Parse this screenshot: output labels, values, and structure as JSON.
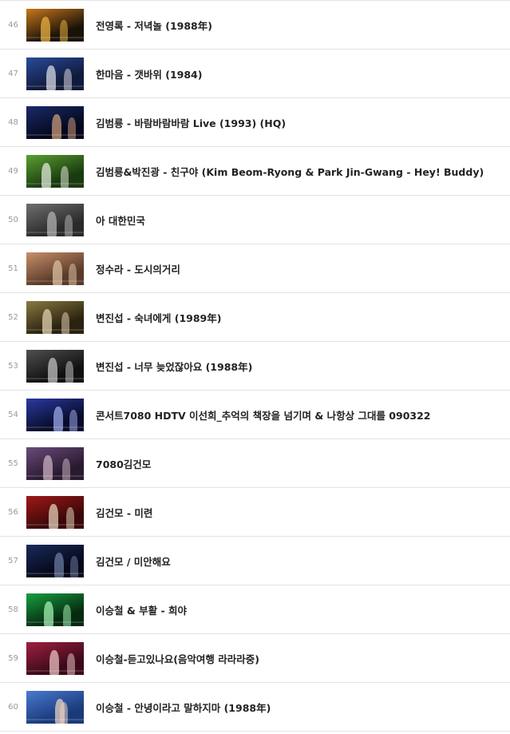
{
  "videos": [
    {
      "index": "46",
      "title": "전영록 - 저녁놀 (1988年)",
      "thumb": "sunset-silhouette-thumbnail",
      "colors": [
        "#1a1208",
        "#c8781c",
        "#e8b040"
      ]
    },
    {
      "index": "47",
      "title": "한마음 - 갯바위 (1984)",
      "thumb": "duet-singers-thumbnail",
      "colors": [
        "#101a3a",
        "#2a4a9a",
        "#d8d8e0"
      ]
    },
    {
      "index": "48",
      "title": "김범룡 - 바람바람바람 Live (1993) (HQ)",
      "thumb": "singer-closeup-thumbnail",
      "colors": [
        "#05081c",
        "#1a2a6a",
        "#c89a7a"
      ]
    },
    {
      "index": "49",
      "title": "김범룡&박진광 - 친구야 (Kim Beom-Ryong & Park Jin-Gwang - Hey! Buddy)",
      "thumb": "green-stage-duo-thumbnail",
      "colors": [
        "#1a3a10",
        "#5aa030",
        "#e0e8d8"
      ]
    },
    {
      "index": "50",
      "title": "아 대한민국",
      "thumb": "city-skyline-thumbnail",
      "colors": [
        "#2a2a2a",
        "#707070",
        "#b0b0b0"
      ]
    },
    {
      "index": "51",
      "title": "정수라 - 도시의거리",
      "thumb": "dancers-stage-thumbnail",
      "colors": [
        "#5a3a2a",
        "#c8906a",
        "#d8c0a0"
      ]
    },
    {
      "index": "52",
      "title": "변진섭 - 숙녀에게 (1989年)",
      "thumb": "woman-portrait-thumbnail",
      "colors": [
        "#2a2210",
        "#8a7a40",
        "#e0d0b0"
      ]
    },
    {
      "index": "53",
      "title": "변진섭 - 너무 늦었잖아요 (1988年)",
      "thumb": "black-white-scene-thumbnail",
      "colors": [
        "#101010",
        "#505050",
        "#c0c0c0"
      ]
    },
    {
      "index": "54",
      "title": "콘서트7080 HDTV 이선희_추억의 책장을 넘기며 & 나항상 그대를 090322",
      "thumb": "concert-stage-blue-thumbnail",
      "colors": [
        "#080c2a",
        "#2a3aa0",
        "#9aa8e8"
      ]
    },
    {
      "index": "55",
      "title": "7080김건모",
      "thumb": "purple-studio-thumbnail",
      "colors": [
        "#2a1a30",
        "#6a4a7a",
        "#c8b0c0"
      ]
    },
    {
      "index": "56",
      "title": "김건모 - 미련",
      "thumb": "singer-red-background-thumbnail",
      "colors": [
        "#3a0808",
        "#a01818",
        "#e0d0b8"
      ]
    },
    {
      "index": "57",
      "title": "김건모 / 미안해요",
      "thumb": "dark-piano-stage-thumbnail",
      "colors": [
        "#050818",
        "#1a2a5a",
        "#6a7aa0"
      ]
    },
    {
      "index": "58",
      "title": "이승철 & 부활 - 희야",
      "thumb": "green-light-stage-thumbnail",
      "colors": [
        "#052a10",
        "#18a040",
        "#a0f0b0"
      ]
    },
    {
      "index": "59",
      "title": "이승철-듣고있나요(음악여행 라라라중)",
      "thumb": "red-stage-thumbnail",
      "colors": [
        "#3a0a18",
        "#a02040",
        "#e8c0c0"
      ]
    },
    {
      "index": "60",
      "title": "이승철 - 안녕이라고 말하지마 (1988年)",
      "thumb": "couple-blue-sky-thumbnail",
      "colors": [
        "#1a3a7a",
        "#4a7ad0",
        "#e8d0c0"
      ]
    }
  ]
}
